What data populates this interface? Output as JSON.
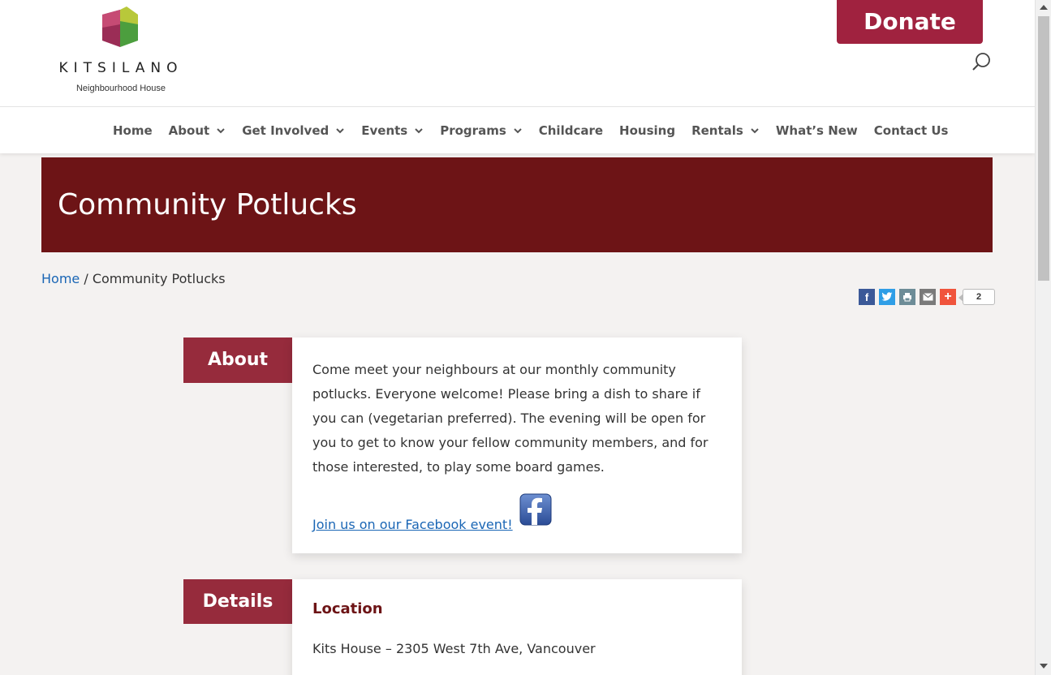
{
  "header": {
    "logo_word": "KITSILANO",
    "logo_sub": "Neighbourhood House",
    "donate_label": "Donate"
  },
  "nav": {
    "items": [
      {
        "label": "Home",
        "has_dropdown": false
      },
      {
        "label": "About",
        "has_dropdown": true
      },
      {
        "label": "Get Involved",
        "has_dropdown": true
      },
      {
        "label": "Events",
        "has_dropdown": true
      },
      {
        "label": "Programs",
        "has_dropdown": true
      },
      {
        "label": "Childcare",
        "has_dropdown": false
      },
      {
        "label": "Housing",
        "has_dropdown": false
      },
      {
        "label": "Rentals",
        "has_dropdown": true
      },
      {
        "label": "What’s New",
        "has_dropdown": false
      },
      {
        "label": "Contact Us",
        "has_dropdown": false
      }
    ]
  },
  "page": {
    "title": "Community Potlucks"
  },
  "breadcrumb": {
    "home": "Home",
    "separator": " / ",
    "current": "Community Potlucks"
  },
  "share": {
    "buttons": [
      "facebook-icon",
      "twitter-icon",
      "print-icon",
      "email-icon",
      "plus-icon"
    ],
    "count": "2"
  },
  "about": {
    "label": "About",
    "text": "Come meet your neighbours at our monthly community potlucks. Everyone welcome! Please bring a dish to share if you can (vegetarian preferred). The evening will be open for you to get to know your fellow community members, and for those interested, to play some board games.",
    "fb_link": "Join us on our Facebook event!"
  },
  "details": {
    "label": "Details",
    "location_title": "Location",
    "location_text": "Kits House – 2305 West 7th Ave, Vancouver"
  },
  "colors": {
    "brand": "#a0223f",
    "banner": "#6d1416",
    "section_label": "#962b3c",
    "link": "#1a66b5"
  }
}
